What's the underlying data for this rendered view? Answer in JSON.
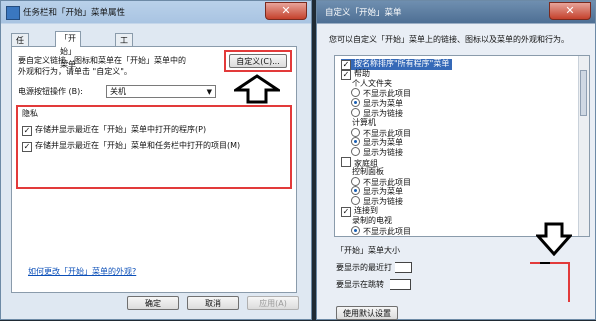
{
  "left_window": {
    "title": "任务栏和「开始」菜单属性",
    "close_glyph": "✕",
    "tabs": [
      "任务栏",
      "「开始」菜单",
      "工具栏"
    ],
    "description_line1": "要自定义链接、图标和菜单在「开始」菜单中的",
    "description_line2": "外观和行为，请单击 \"自定义\"。",
    "customize_button": "自定义(C)...",
    "power_button_label": "电源按钮操作 (B):",
    "power_button_value": "关机",
    "privacy": {
      "title": "隐私",
      "items": [
        "存储并显示最近在「开始」菜单中打开的程序(P)",
        "存储并显示最近在「开始」菜单和任务栏中打开的项目(M)"
      ]
    },
    "help_link": "如何更改「开始」菜单的外观?",
    "buttons": {
      "ok": "确定",
      "cancel": "取消",
      "apply": "应用(A)"
    }
  },
  "right_window": {
    "title": "自定义「开始」菜单",
    "close_glyph": "✕",
    "intro": "您可以自定义「开始」菜单上的链接、图标以及菜单的外观和行为。",
    "list": [
      {
        "type": "check",
        "label": "按名称排序\"所有程序\"菜单",
        "checked": true,
        "highlight": true
      },
      {
        "type": "check",
        "label": "帮助",
        "checked": true
      },
      {
        "type": "heading",
        "label": "个人文件夹"
      },
      {
        "type": "radio",
        "label": "不显示此项目",
        "on": false
      },
      {
        "type": "radio",
        "label": "显示为菜单",
        "on": true
      },
      {
        "type": "radio",
        "label": "显示为链接",
        "on": false
      },
      {
        "type": "heading",
        "label": "计算机"
      },
      {
        "type": "radio",
        "label": "不显示此项目",
        "on": false
      },
      {
        "type": "radio",
        "label": "显示为菜单",
        "on": true
      },
      {
        "type": "radio",
        "label": "显示为链接",
        "on": false
      },
      {
        "type": "check",
        "label": "家庭组",
        "checked": false
      },
      {
        "type": "heading",
        "label": "控制面板"
      },
      {
        "type": "radio",
        "label": "不显示此项目",
        "on": false
      },
      {
        "type": "radio",
        "label": "显示为菜单",
        "on": true
      },
      {
        "type": "radio",
        "label": "显示为链接",
        "on": false
      },
      {
        "type": "check",
        "label": "连接到",
        "checked": true
      },
      {
        "type": "heading",
        "label": "录制的电视"
      },
      {
        "type": "radio",
        "label": "不显示此项目",
        "on": true
      }
    ],
    "size_section": "「开始」菜单大小",
    "recent_label": "要显示的最近打",
    "jumplist_label": "要显示在跳转",
    "default_button": "使用默认设置"
  }
}
